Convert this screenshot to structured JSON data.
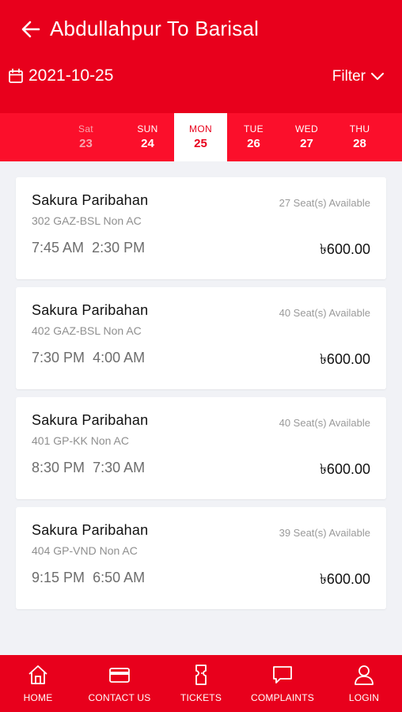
{
  "header": {
    "title": "Abdullahpur To Barisal",
    "date": "2021-10-25",
    "filter_label": "Filter"
  },
  "days": [
    {
      "name": "Sat",
      "date": "23",
      "state": "past"
    },
    {
      "name": "SUN",
      "date": "24",
      "state": "normal"
    },
    {
      "name": "MON",
      "date": "25",
      "state": "active"
    },
    {
      "name": "TUE",
      "date": "26",
      "state": "normal"
    },
    {
      "name": "WED",
      "date": "27",
      "state": "normal"
    },
    {
      "name": "THU",
      "date": "28",
      "state": "normal"
    }
  ],
  "trips": [
    {
      "operator": "Sakura Paribahan",
      "coach": "302 GAZ-BSL Non AC",
      "departure": "7:45 AM",
      "arrival": "2:30 PM",
      "seats": "27 Seat(s) Available",
      "price": "৳600.00"
    },
    {
      "operator": "Sakura Paribahan",
      "coach": "402 GAZ-BSL Non AC",
      "departure": "7:30 PM",
      "arrival": "4:00 AM",
      "seats": "40 Seat(s) Available",
      "price": "৳600.00"
    },
    {
      "operator": "Sakura Paribahan",
      "coach": "401 GP-KK Non AC",
      "departure": "8:30 PM",
      "arrival": "7:30 AM",
      "seats": "40 Seat(s) Available",
      "price": "৳600.00"
    },
    {
      "operator": "Sakura Paribahan",
      "coach": "404 GP-VND Non AC",
      "departure": "9:15 PM",
      "arrival": "6:50 AM",
      "seats": "39 Seat(s) Available",
      "price": "৳600.00"
    }
  ],
  "nav": [
    {
      "label": "HOME",
      "icon": "home-icon"
    },
    {
      "label": "CONTACT US",
      "icon": "card-icon"
    },
    {
      "label": "TICKETS",
      "icon": "ticket-icon"
    },
    {
      "label": "COMPLAINTS",
      "icon": "chat-icon"
    },
    {
      "label": "LOGIN",
      "icon": "user-icon"
    }
  ],
  "colors": {
    "primary": "#e8001c",
    "day_strip": "#fb0f2b",
    "background": "#f1f2f6"
  }
}
